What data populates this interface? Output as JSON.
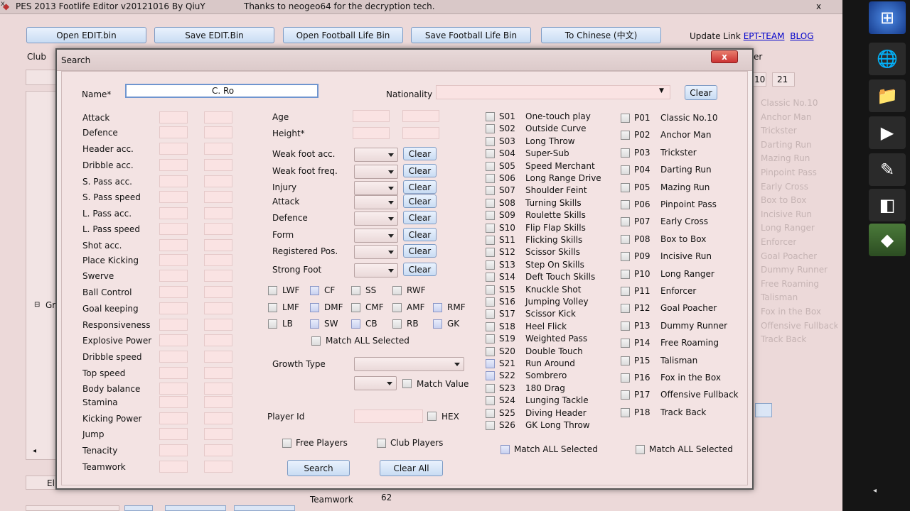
{
  "app": {
    "title": "PES 2013 Footlife Editor v20121016 By QiuY",
    "thanks": "Thanks to neogeo64 for the decryption tech.",
    "close_glyph": "x",
    "toolbar": [
      "Open EDIT.bin",
      "Save EDIT.Bin",
      "Open Football Life Bin",
      "Save Football Life Bin",
      "To Chinese (中文)"
    ],
    "update_label": "Update Link",
    "links": [
      "EPT-TEAM",
      "BLOG"
    ],
    "club_label": "Club",
    "num_a": "10",
    "num_b": "21",
    "tree_node": "Gr",
    "bottom_left": "El",
    "teamwork_label": "Teamwork",
    "teamwork_value": "62",
    "bg_ghost_items": [
      "Classic No.10",
      "Anchor Man",
      "Trickster",
      "Darting Run",
      "Mazing Run",
      "Pinpoint Pass",
      "Early Cross",
      "Box to Box",
      "Incisive Run",
      "Long Ranger",
      "Enforcer",
      "Goal Poacher",
      "Dummy Runner",
      "Free Roaming",
      "Talisman",
      "Fox in the Box",
      "Offensive Fullback",
      "Track Back"
    ]
  },
  "dialog": {
    "title": "Search",
    "close_glyph": "x",
    "name_label": "Name*",
    "name_value": "C. Ro",
    "nationality_label": "Nationality",
    "clear": "Clear",
    "stats": [
      "Attack",
      "Defence",
      "Header acc.",
      "Dribble acc.",
      "S. Pass acc.",
      "S. Pass speed",
      "L. Pass acc.",
      "L. Pass speed",
      "Shot acc.",
      "Place Kicking",
      "Swerve",
      "Ball Control",
      "Goal keeping",
      "Responsiveness",
      "Explosive Power",
      "Dribble speed",
      "Top speed",
      "Body balance",
      "Stamina",
      "Kicking Power",
      "Jump",
      "Tenacity",
      "Teamwork"
    ],
    "age_label": "Age",
    "height_label": "Height*",
    "attrs": [
      "Weak foot acc.",
      "Weak foot freq.",
      "Injury",
      "Attack",
      "Defence",
      "Form",
      "Registered Pos.",
      "Strong Foot"
    ],
    "positions": [
      [
        "LWF",
        "CF",
        "SS",
        "RWF"
      ],
      [
        "LMF",
        "DMF",
        "CMF",
        "AMF",
        "RMF"
      ],
      [
        "LB",
        "SW",
        "CB",
        "RB",
        "GK"
      ]
    ],
    "match_all": "Match ALL Selected",
    "growth_label": "Growth Type",
    "match_value": "Match Value",
    "player_id_label": "Player Id",
    "hex_label": "HEX",
    "free_players": "Free Players",
    "club_players": "Club Players",
    "search_btn": "Search",
    "clear_all_btn": "Clear All",
    "skills": [
      [
        "S01",
        "One-touch play"
      ],
      [
        "S02",
        "Outside Curve"
      ],
      [
        "S03",
        "Long Throw"
      ],
      [
        "S04",
        "Super-Sub"
      ],
      [
        "S05",
        "Speed Merchant"
      ],
      [
        "S06",
        "Long Range Drive"
      ],
      [
        "S07",
        "Shoulder Feint"
      ],
      [
        "S08",
        "Turning Skills"
      ],
      [
        "S09",
        "Roulette Skills"
      ],
      [
        "S10",
        "Flip Flap Skills"
      ],
      [
        "S11",
        "Flicking Skills"
      ],
      [
        "S12",
        "Scissor Skills"
      ],
      [
        "S13",
        "Step On Skills"
      ],
      [
        "S14",
        "Deft Touch Skills"
      ],
      [
        "S15",
        "Knuckle Shot"
      ],
      [
        "S16",
        "Jumping Volley"
      ],
      [
        "S17",
        "Scissor Kick"
      ],
      [
        "S18",
        "Heel Flick"
      ],
      [
        "S19",
        "Weighted Pass"
      ],
      [
        "S20",
        "Double Touch"
      ],
      [
        "S21",
        "Run Around"
      ],
      [
        "S22",
        "Sombrero"
      ],
      [
        "S23",
        "180 Drag"
      ],
      [
        "S24",
        "Lunging Tackle"
      ],
      [
        "S25",
        "Diving Header"
      ],
      [
        "S26",
        "GK Long Throw"
      ]
    ],
    "play_styles": [
      [
        "P01",
        "Classic No.10"
      ],
      [
        "P02",
        "Anchor Man"
      ],
      [
        "P03",
        "Trickster"
      ],
      [
        "P04",
        "Darting Run"
      ],
      [
        "P05",
        "Mazing Run"
      ],
      [
        "P06",
        "Pinpoint Pass"
      ],
      [
        "P07",
        "Early Cross"
      ],
      [
        "P08",
        "Box to Box"
      ],
      [
        "P09",
        "Incisive Run"
      ],
      [
        "P10",
        "Long Ranger"
      ],
      [
        "P11",
        "Enforcer"
      ],
      [
        "P12",
        "Goal Poacher"
      ],
      [
        "P13",
        "Dummy Runner"
      ],
      [
        "P14",
        "Free Roaming"
      ],
      [
        "P15",
        "Talisman"
      ],
      [
        "P16",
        "Fox in the Box"
      ],
      [
        "P17",
        "Offensive Fullback"
      ],
      [
        "P18",
        "Track Back"
      ]
    ]
  }
}
